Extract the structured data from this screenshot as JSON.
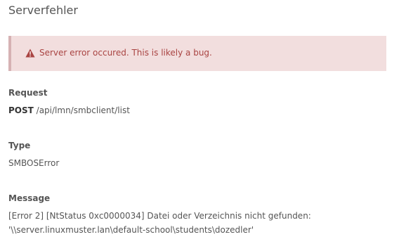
{
  "dialog": {
    "title": "Serverfehler"
  },
  "alert": {
    "icon": "warning-triangle-icon",
    "message": "Server error occured. This is likely a bug.",
    "text_color": "#a94442",
    "background": "#f2dede"
  },
  "request": {
    "label": "Request",
    "method": "POST",
    "path": "/api/lmn/smbclient/list"
  },
  "type": {
    "label": "Type",
    "value": "SMBOSError"
  },
  "message": {
    "label": "Message",
    "line1": "[Error 2] [NtStatus 0xc0000034] Datei oder Verzeichnis nicht gefunden:",
    "line2": "'\\\\server.linuxmuster.lan\\default-school\\students\\dozedler'"
  }
}
